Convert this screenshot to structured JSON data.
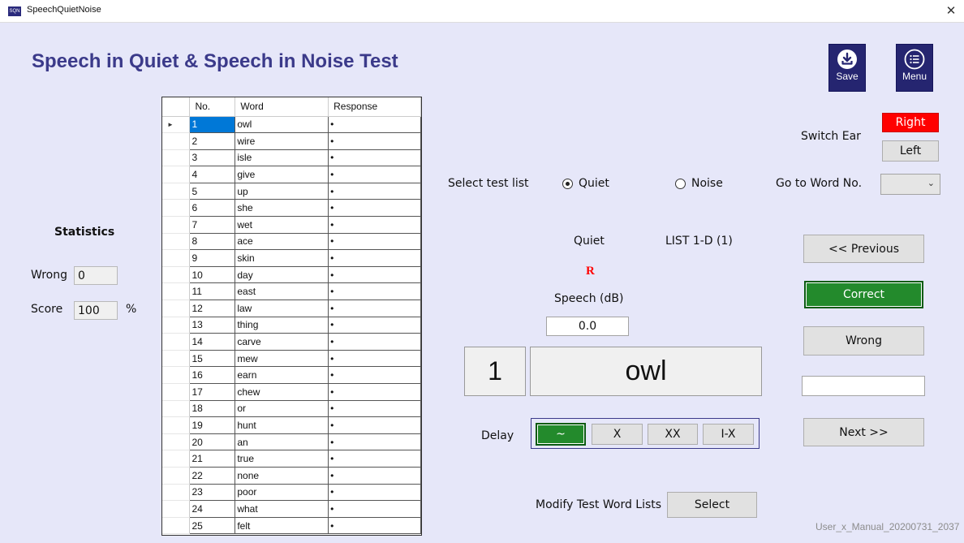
{
  "window": {
    "title": "SpeechQuietNoise",
    "icon_text": "SQN",
    "close_glyph": "✕"
  },
  "app": {
    "title": "Speech in Quiet & Speech in Noise Test"
  },
  "toolbar": {
    "save_label": "Save",
    "menu_label": "Menu"
  },
  "statistics": {
    "heading": "Statistics",
    "wrong_label": "Wrong",
    "wrong_value": "0",
    "score_label": "Score",
    "score_value": "100",
    "score_unit": "%"
  },
  "grid": {
    "columns": [
      "No.",
      "Word",
      "Response"
    ],
    "selected_row": 1,
    "row_marker": "►",
    "rows": [
      {
        "no": "1",
        "word": "owl",
        "response": "•"
      },
      {
        "no": "2",
        "word": "wire",
        "response": "•"
      },
      {
        "no": "3",
        "word": "isle",
        "response": "•"
      },
      {
        "no": "4",
        "word": "give",
        "response": "•"
      },
      {
        "no": "5",
        "word": "up",
        "response": "•"
      },
      {
        "no": "6",
        "word": "she",
        "response": "•"
      },
      {
        "no": "7",
        "word": "wet",
        "response": "•"
      },
      {
        "no": "8",
        "word": "ace",
        "response": "•"
      },
      {
        "no": "9",
        "word": "skin",
        "response": "•"
      },
      {
        "no": "10",
        "word": "day",
        "response": "•"
      },
      {
        "no": "11",
        "word": "east",
        "response": "•"
      },
      {
        "no": "12",
        "word": "law",
        "response": "•"
      },
      {
        "no": "13",
        "word": "thing",
        "response": "•"
      },
      {
        "no": "14",
        "word": "carve",
        "response": "•"
      },
      {
        "no": "15",
        "word": "mew",
        "response": "•"
      },
      {
        "no": "16",
        "word": "earn",
        "response": "•"
      },
      {
        "no": "17",
        "word": "chew",
        "response": "•"
      },
      {
        "no": "18",
        "word": "or",
        "response": "•"
      },
      {
        "no": "19",
        "word": "hunt",
        "response": "•"
      },
      {
        "no": "20",
        "word": "an",
        "response": "•"
      },
      {
        "no": "21",
        "word": "true",
        "response": "•"
      },
      {
        "no": "22",
        "word": "none",
        "response": "•"
      },
      {
        "no": "23",
        "word": "poor",
        "response": "•"
      },
      {
        "no": "24",
        "word": "what",
        "response": "•"
      },
      {
        "no": "25",
        "word": "felt",
        "response": "•"
      }
    ]
  },
  "test_list": {
    "label": "Select test list",
    "quiet_label": "Quiet",
    "noise_label": "Noise",
    "selected": "Quiet"
  },
  "ear": {
    "label": "Switch Ear",
    "right_label": "Right",
    "left_label": "Left",
    "active": "Right",
    "active_color": "#ff0000"
  },
  "goto": {
    "label": "Go to Word No.",
    "value": ""
  },
  "status": {
    "mode": "Quiet",
    "list": "LIST 1-D (1)",
    "ear_indicator": "R",
    "ear_indicator_color": "#ff0000",
    "speech_label": "Speech (dB)",
    "speech_value": "0.0"
  },
  "current": {
    "number": "1",
    "word": "owl"
  },
  "delay": {
    "label": "Delay",
    "options": [
      "~",
      "X",
      "XX",
      "I-X"
    ],
    "selected": "~"
  },
  "nav": {
    "previous_label": "<< Previous",
    "correct_label": "Correct",
    "wrong_label": "Wrong",
    "next_label": "Next >>",
    "blank_value": ""
  },
  "modify": {
    "label": "Modify Test Word Lists",
    "button_label": "Select"
  },
  "version": "User_x_Manual_20200731_2037",
  "colors": {
    "title": "#3b3a8a",
    "background": "#e6e7f9",
    "accent_green": "#238a2c",
    "toolbar": "#252570"
  }
}
